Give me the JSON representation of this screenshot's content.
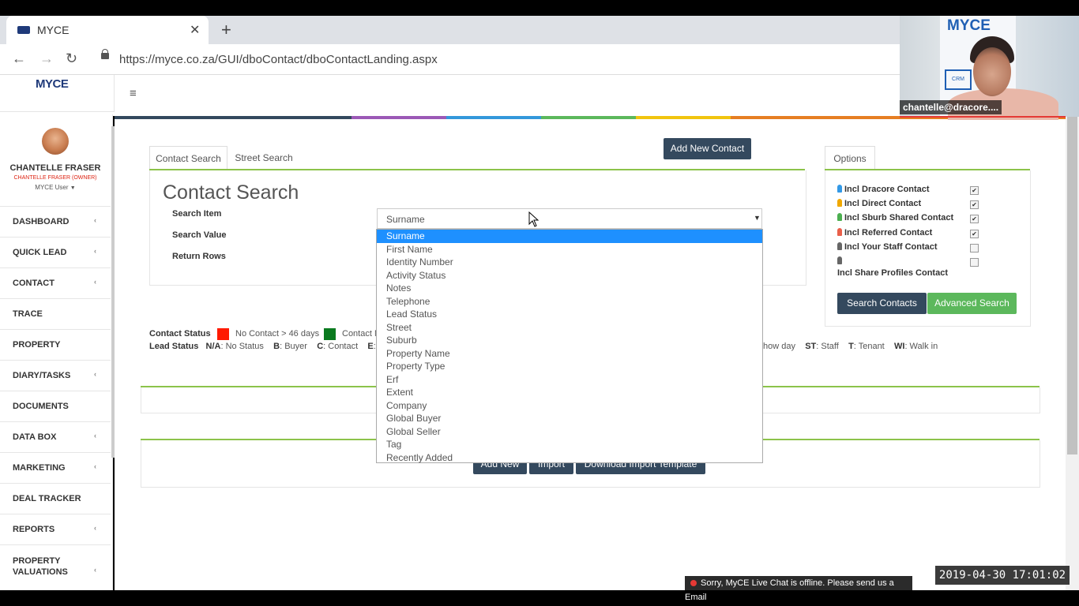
{
  "browser": {
    "tab_title": "MYCE",
    "url": "https://myce.co.za/GUI/dboContact/dboContactLanding.aspx",
    "icons": {
      "back": "arrow-left-icon",
      "forward": "arrow-right-icon",
      "reload": "reload-icon",
      "close": "close-icon",
      "new_tab": "plus-icon",
      "lock": "lock-icon"
    }
  },
  "header": {
    "logo": "MYCE",
    "menu_icon": "hamburger-icon"
  },
  "user": {
    "name": "CHANTELLE FRASER",
    "owner_line": "CHANTELLE FRASER (OWNER)",
    "role": "MYCE User"
  },
  "sidebar": {
    "items": [
      {
        "label": "DASHBOARD",
        "chevron": "‹"
      },
      {
        "label": "QUICK LEAD",
        "chevron": "‹"
      },
      {
        "label": "CONTACT",
        "chevron": "‹"
      },
      {
        "label": "TRACE",
        "chevron": ""
      },
      {
        "label": "PROPERTY",
        "chevron": ""
      },
      {
        "label": "DIARY/TASKS",
        "chevron": "‹"
      },
      {
        "label": "DOCUMENTS",
        "chevron": ""
      },
      {
        "label": "DATA BOX",
        "chevron": "‹"
      },
      {
        "label": "MARKETING",
        "chevron": "‹"
      },
      {
        "label": "DEAL TRACKER",
        "chevron": ""
      },
      {
        "label": "REPORTS",
        "chevron": "‹"
      },
      {
        "label": "PROPERTY",
        "chevron": "‹"
      },
      {
        "label": "VALUATIONS",
        "chevron": ""
      }
    ]
  },
  "tabs": {
    "contact_search": "Contact Search",
    "street_search": "Street Search",
    "options": "Options"
  },
  "main": {
    "add_new_contact": "Add New Contact",
    "title": "Contact Search",
    "labels": {
      "search_item": "Search Item",
      "search_value": "Search Value",
      "return_rows": "Return Rows"
    },
    "search_item_value": "Surname",
    "dropdown_options": [
      "Surname",
      "First Name",
      "Identity Number",
      "Activity Status",
      "Notes",
      "Telephone",
      "Lead Status",
      "Street",
      "Suburb",
      "Property Name",
      "Property Type",
      "Erf",
      "Extent",
      "Company",
      "Global Buyer",
      "Global Seller",
      "Tag",
      "Recently Added"
    ],
    "selected_option": "Surname"
  },
  "legend": {
    "contact_status": "Contact Status",
    "no_contact": "No Contact > 46 days",
    "contact_partial": "Contact M",
    "lead_status": "Lead Status",
    "na_key": "N/A",
    "na_val": ": No Status",
    "b_key": "B",
    "b_val": ": Buyer",
    "c_key": "C",
    "c_val": ": Contact",
    "e_key": "E",
    "e_val": ": E",
    "show_day": "how day",
    "st_key": "ST",
    "st_val": ": Staff",
    "t_key": "T",
    "t_val": ": Tenant",
    "wi_key": "WI",
    "wi_val": ": Walk in",
    "colors": {
      "red": "#ff1a00",
      "green": "#0a7a1f"
    }
  },
  "actions": {
    "add_new": "Add New",
    "import": "Import",
    "download_template": "Download Import Template"
  },
  "options": {
    "items": [
      {
        "label": "Incl Dracore Contact",
        "checked": true,
        "pin_color": "#3399e6"
      },
      {
        "label": "Incl Direct Contact",
        "checked": true,
        "pin_color": "#f0a800"
      },
      {
        "label": "Incl Sburb Shared Contact",
        "checked": true,
        "pin_color": "#4caf50"
      },
      {
        "label": "Incl Referred Contact",
        "checked": true,
        "pin_color": "#e9604a"
      },
      {
        "label": "Incl Your Staff Contact",
        "checked": false,
        "pin_color": "#666666"
      },
      {
        "label": "Incl Share Profiles Contact",
        "checked": false,
        "pin_color": "#666666"
      }
    ],
    "search_contacts": "Search Contacts",
    "advanced_search": "Advanced Search"
  },
  "video": {
    "label": "chantelle@dracore....",
    "banner_logo": "MYCE",
    "banner_text": "CRM"
  },
  "chat": {
    "text": "Sorry, MyCE Live Chat is offline. Please send us a Email"
  },
  "timestamp": "2019-04-30  17:01:02",
  "colors": {
    "accent_green": "#8cc34a",
    "dark_button": "#34495e",
    "green_button": "#5cb85c",
    "selection": "#1e90ff"
  }
}
